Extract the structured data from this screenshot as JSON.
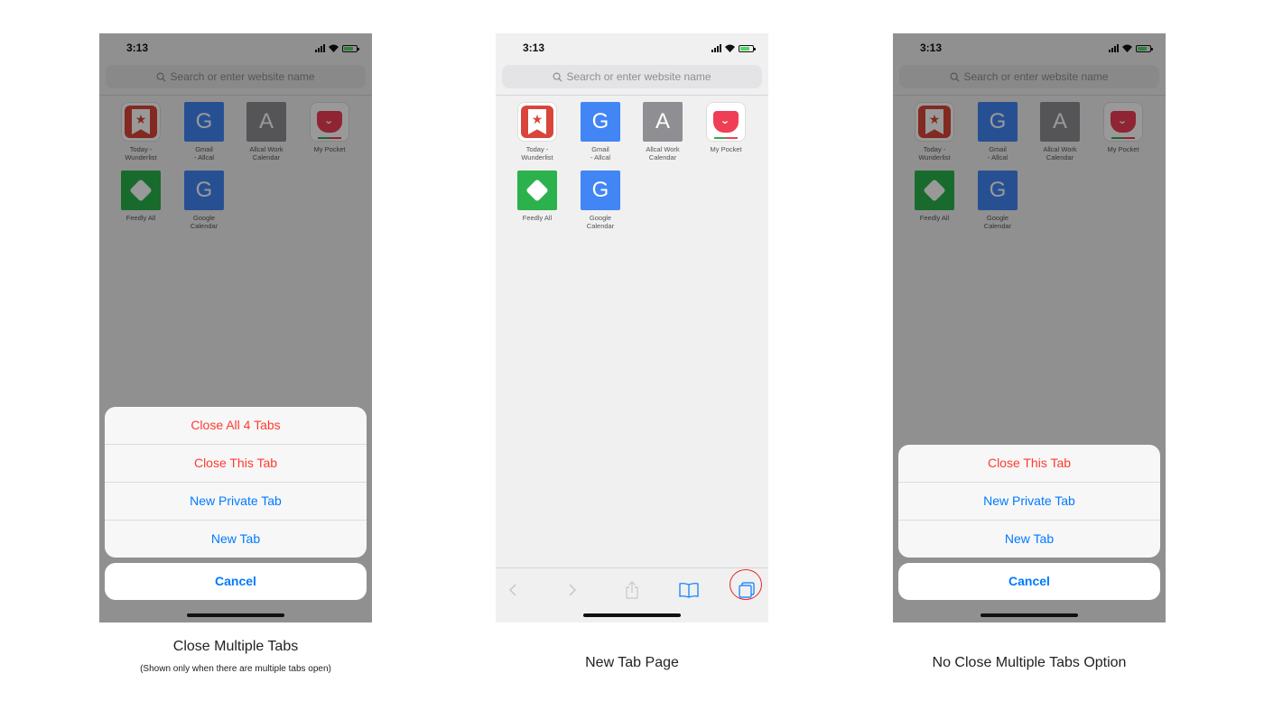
{
  "status": {
    "time": "3:13"
  },
  "search": {
    "placeholder": "Search or enter website name"
  },
  "favorites": [
    {
      "label": "Today -\nWunderlist",
      "icon": "wunderlist-icon",
      "glyph": "★"
    },
    {
      "label": "Gmail\n- Allcal",
      "icon": "google-icon",
      "glyph": "G"
    },
    {
      "label": "Allcal Work\nCalendar",
      "icon": "letter-a-icon",
      "glyph": "A"
    },
    {
      "label": "My Pocket",
      "icon": "pocket-icon",
      "glyph": "›"
    },
    {
      "label": "Feedly All",
      "icon": "feedly-icon",
      "glyph": ""
    },
    {
      "label": "Google\nCalendar",
      "icon": "google-icon",
      "glyph": "G"
    }
  ],
  "screen1": {
    "options": [
      "Close All 4 Tabs",
      "Close This Tab",
      "New Private Tab",
      "New Tab"
    ],
    "cancel": "Cancel",
    "caption": "Close Multiple Tabs",
    "subcaption": "(Shown only when there are multiple tabs open)"
  },
  "screen2": {
    "caption": "New Tab Page",
    "toolbar": [
      "back-icon",
      "forward-icon",
      "share-icon",
      "bookmarks-icon",
      "tabs-icon"
    ]
  },
  "screen3": {
    "options": [
      "Close This Tab",
      "New Private Tab",
      "New Tab"
    ],
    "cancel": "Cancel",
    "caption": "No Close Multiple Tabs Option"
  },
  "colors": {
    "destructive": "#ff3b30",
    "action": "#007aff",
    "highlight": "#e8242a"
  }
}
